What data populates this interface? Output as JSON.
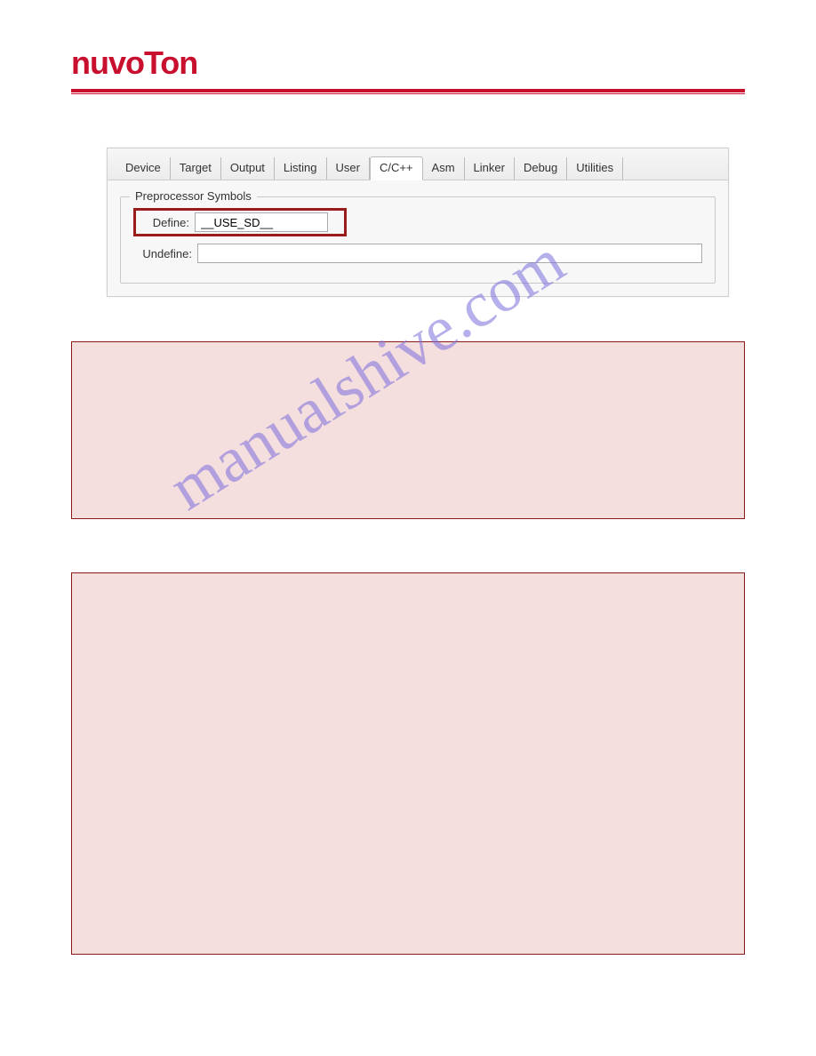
{
  "header": {
    "logo_text": "nuvoTon"
  },
  "ide": {
    "tabs": [
      {
        "label": "Device",
        "active": false
      },
      {
        "label": "Target",
        "active": false
      },
      {
        "label": "Output",
        "active": false
      },
      {
        "label": "Listing",
        "active": false
      },
      {
        "label": "User",
        "active": false
      },
      {
        "label": "C/C++",
        "active": true
      },
      {
        "label": "Asm",
        "active": false
      },
      {
        "label": "Linker",
        "active": false
      },
      {
        "label": "Debug",
        "active": false
      },
      {
        "label": "Utilities",
        "active": false
      }
    ],
    "group_title": "Preprocessor Symbols",
    "define_label": "Define:",
    "define_value": "__USE_SD__",
    "undefine_label": "Undefine:",
    "undefine_value": ""
  },
  "watermark": "manualshive.com"
}
